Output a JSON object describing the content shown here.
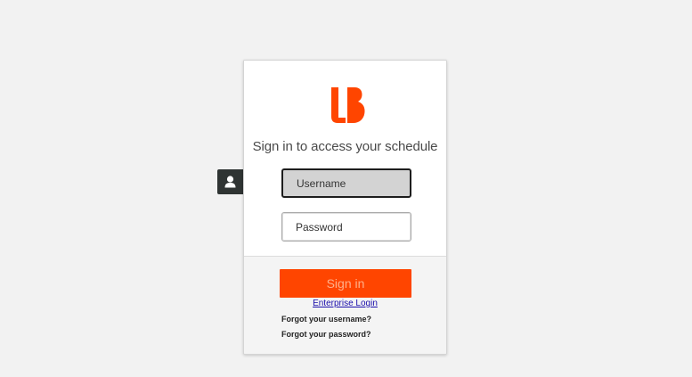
{
  "brand": {
    "logo_icon": "brand-logo-icon",
    "accent_color": "#ff4500"
  },
  "login": {
    "heading": "Sign in to access your schedule",
    "username_placeholder": "Username",
    "password_placeholder": "Password",
    "signin_label": "Sign in",
    "enterprise_link": "Enterprise Login",
    "forgot_username": "Forgot your username?",
    "forgot_password": "Forgot your password?"
  },
  "side_tab": {
    "icon": "user-icon"
  }
}
